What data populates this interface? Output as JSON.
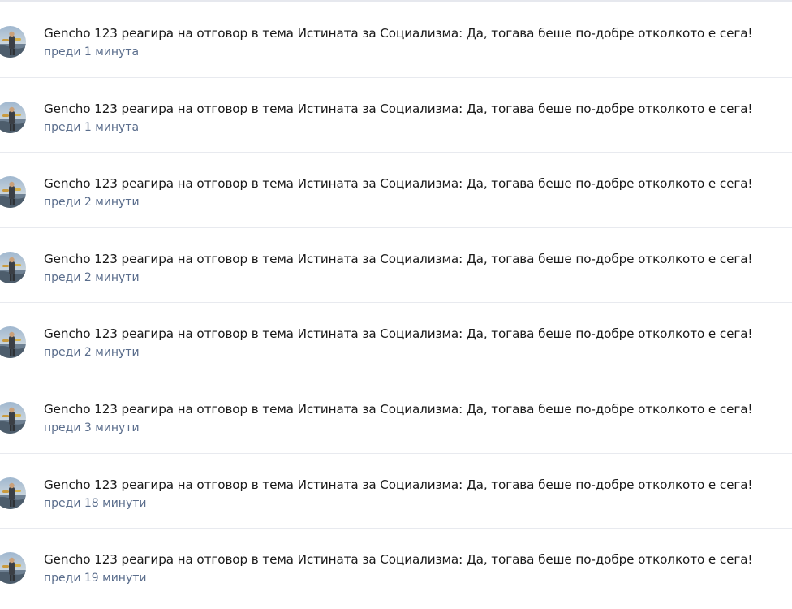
{
  "notifications": [
    {
      "text": "Gencho 123 реагира на отговор в тема Истината за Социализма: Да, тогава беше по-добре отколкото е сега!",
      "time": "преди 1 минута"
    },
    {
      "text": "Gencho 123 реагира на отговор в тема Истината за Социализма: Да, тогава беше по-добре отколкото е сега!",
      "time": "преди 1 минута"
    },
    {
      "text": "Gencho 123 реагира на отговор в тема Истината за Социализма: Да, тогава беше по-добре отколкото е сега!",
      "time": "преди 2 минути"
    },
    {
      "text": "Gencho 123 реагира на отговор в тема Истината за Социализма: Да, тогава беше по-добре отколкото е сега!",
      "time": "преди 2 минути"
    },
    {
      "text": "Gencho 123 реагира на отговор в тема Истината за Социализма: Да, тогава беше по-добре отколкото е сега!",
      "time": "преди 2 минути"
    },
    {
      "text": "Gencho 123 реагира на отговор в тема Истината за Социализма: Да, тогава беше по-добре отколкото е сега!",
      "time": "преди 3 минути"
    },
    {
      "text": "Gencho 123 реагира на отговор в тема Истината за Социализма: Да, тогава беше по-добре отколкото е сега!",
      "time": "преди 18 минути"
    },
    {
      "text": "Gencho 123 реагира на отговор в тема Истината за Социализма: Да, тогава беше по-добре отколкото е сега!",
      "time": "преди 19 минути"
    }
  ],
  "colors": {
    "text": "#1a1a1a",
    "time": "#5a6d8c",
    "divider": "#e8eaef"
  },
  "icons": {
    "avatar": "user-avatar-photo"
  }
}
